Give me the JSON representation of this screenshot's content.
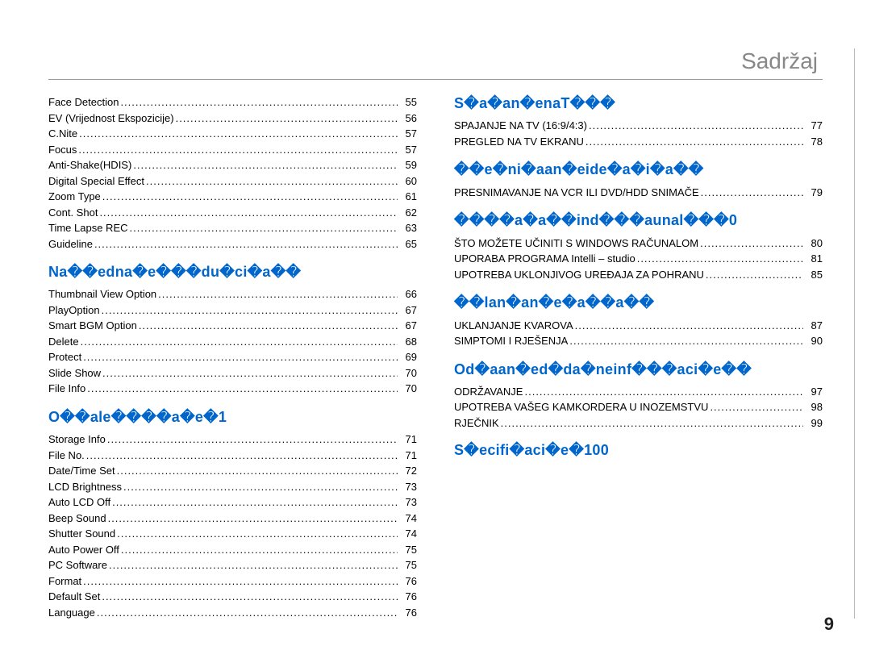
{
  "header": {
    "title": "Sadržaj"
  },
  "page_number": "9",
  "left": {
    "group1": [
      {
        "label": "Face Detection",
        "page": "55"
      },
      {
        "label": "EV (Vrijednost Ekspozicije)",
        "page": "56"
      },
      {
        "label": "C.Nite",
        "page": "57"
      },
      {
        "label": "Focus",
        "page": "57"
      },
      {
        "label": "Anti-Shake(HDIS)",
        "page": "59"
      },
      {
        "label": "Digital Special Effect",
        "page": "60"
      },
      {
        "label": "Zoom Type",
        "page": "61"
      },
      {
        "label": "Cont. Shot",
        "page": "62"
      },
      {
        "label": "Time Lapse REC",
        "page": "63"
      },
      {
        "label": "Guideline",
        "page": "65"
      }
    ],
    "heading2": "Na��edna�e���du�ci�a��",
    "group2": [
      {
        "label": "Thumbnail View Option",
        "page": "66"
      },
      {
        "label": "PlayOption",
        "page": "67"
      },
      {
        "label": "Smart BGM Option",
        "page": "67"
      },
      {
        "label": "Delete",
        "page": "68"
      },
      {
        "label": "Protect",
        "page": "69"
      },
      {
        "label": "Slide Show",
        "page": "70"
      },
      {
        "label": "File Info",
        "page": "70"
      }
    ],
    "heading3": "O��ale����a�e�1",
    "group3": [
      {
        "label": "Storage Info",
        "page": "71"
      },
      {
        "label": "File No.",
        "page": "71"
      },
      {
        "label": "Date/Time Set",
        "page": "72"
      },
      {
        "label": "LCD Brightness",
        "page": "73"
      },
      {
        "label": "Auto LCD Off",
        "page": "73"
      },
      {
        "label": "Beep Sound",
        "page": "74"
      },
      {
        "label": "Shutter Sound",
        "page": "74"
      },
      {
        "label": "Auto Power Off",
        "page": "75"
      },
      {
        "label": "PC Software",
        "page": "75"
      },
      {
        "label": "Format",
        "page": "76"
      },
      {
        "label": "Default Set",
        "page": "76"
      },
      {
        "label": "Language",
        "page": "76"
      }
    ]
  },
  "right": {
    "heading1": "S�a�an�enaT���",
    "group1": [
      {
        "label": "SPAJANJE NA TV (16:9/4:3)",
        "page": "77"
      },
      {
        "label": "PREGLED NA TV EKRANU",
        "page": "78"
      }
    ],
    "heading2": "��e�ni�aan�eide�a�i�a��",
    "group2": [
      {
        "label": "PRESNIMAVANJE NA VCR ILI DVD/HDD SNIMAČE",
        "page": "79"
      }
    ],
    "heading3": "����a�a��ind���aunal���0",
    "group3": [
      {
        "label": "ŠTO MOŽETE UČINITI S WINDOWS RAČUNALOM",
        "page": "80"
      },
      {
        "label": "UPORABA PROGRAMA Intelli – studio",
        "page": "81"
      },
      {
        "label": "UPOTREBA UKLONJIVOG UREĐAJA ZA POHRANU",
        "page": "85"
      }
    ],
    "heading4": "��lan�an�e�a��a��",
    "group4": [
      {
        "label": "UKLANJANJE KVAROVA",
        "page": "87"
      },
      {
        "label": "SIMPTOMI I RJEŠENJA",
        "page": "90"
      }
    ],
    "heading5": "Od�aan�ed�da�neinf���aci�e��",
    "group5": [
      {
        "label": "ODRŽAVANJE",
        "page": "97"
      },
      {
        "label": "UPOTREBA VAŠEG KAMKORDERA U INOZEMSTVU",
        "page": "98"
      },
      {
        "label": "RJEČNIK",
        "page": "99"
      }
    ],
    "heading6": "S�ecifi�aci�e�100"
  }
}
